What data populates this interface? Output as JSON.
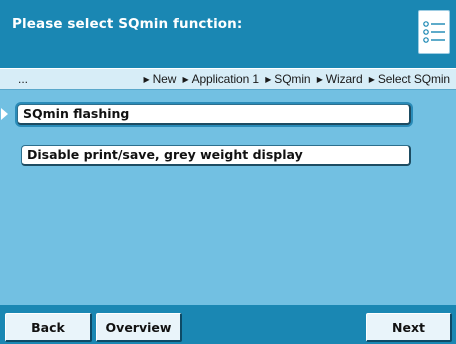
{
  "header": {
    "title": "Please select SQmin function:",
    "menu_icon": "list-menu-icon"
  },
  "breadcrumb": {
    "ellipsis": "...",
    "items": [
      "New",
      "Application 1",
      "SQmin",
      "Wizard",
      "Select SQmin"
    ],
    "separator_icon": "triangle-right-icon"
  },
  "options": [
    {
      "label": "SQmin flashing",
      "selected": true
    },
    {
      "label": "Disable print/save, grey weight display",
      "selected": false
    }
  ],
  "footer": {
    "back_label": "Back",
    "overview_label": "Overview",
    "next_label": "Next"
  },
  "colors": {
    "header_bg": "#1a87b3",
    "body_bg": "#72c0e2",
    "breadcrumb_bg": "#d7edf7",
    "button_bg": "#ffffff"
  }
}
